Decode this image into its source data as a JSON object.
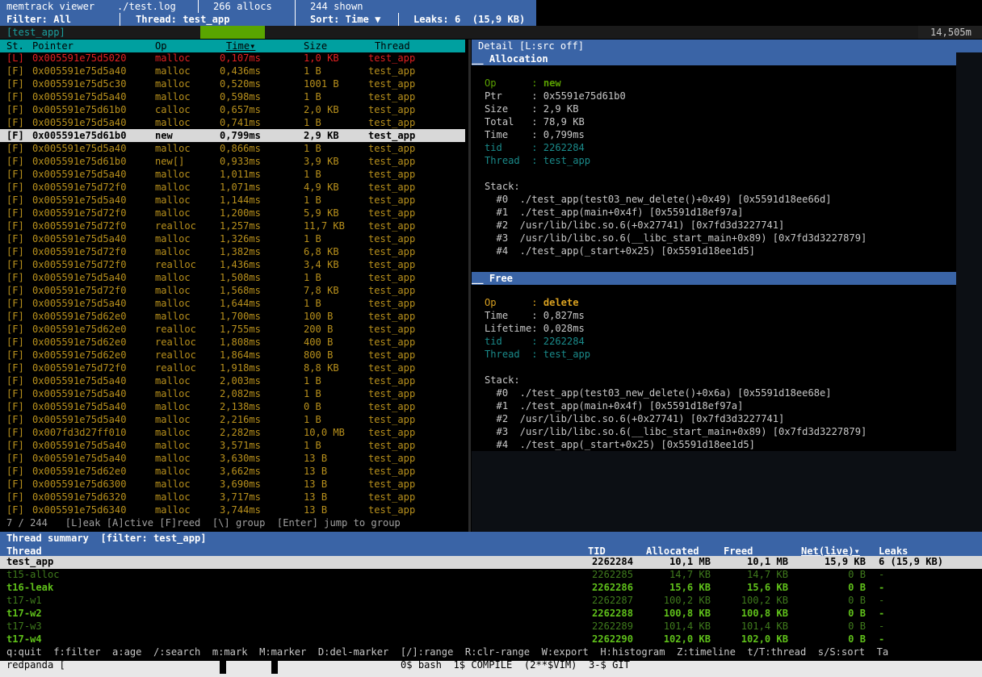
{
  "header": {
    "app_title": "memtrack viewer",
    "file": "./test.log",
    "allocs": "266 allocs",
    "shown": "244 shown",
    "filter": "Filter: All",
    "thread": "Thread: test_app",
    "sort": "Sort: Time ▼",
    "leaks": "Leaks: 6  (15,9 KB)"
  },
  "tabbar": {
    "group": "[test_app]",
    "right": "14,505m"
  },
  "list": {
    "columns": {
      "st": "St.",
      "pointer": "Pointer",
      "op": "Op",
      "time": "Time▾",
      "size": "Size",
      "thread": "Thread"
    },
    "rows": [
      {
        "st": "[L]",
        "ptr": "0x005591e75d5020",
        "op": "malloc",
        "time": "0,107ms",
        "size": "1,0 KB",
        "thread": "test_app",
        "kind": "leak"
      },
      {
        "st": "[F]",
        "ptr": "0x005591e75d5a40",
        "op": "malloc",
        "time": "0,436ms",
        "size": "1 B",
        "thread": "test_app",
        "kind": "freed"
      },
      {
        "st": "[F]",
        "ptr": "0x005591e75d5c30",
        "op": "malloc",
        "time": "0,520ms",
        "size": "1001 B",
        "thread": "test_app",
        "kind": "freed"
      },
      {
        "st": "[F]",
        "ptr": "0x005591e75d5a40",
        "op": "malloc",
        "time": "0,598ms",
        "size": "1 B",
        "thread": "test_app",
        "kind": "freed"
      },
      {
        "st": "[F]",
        "ptr": "0x005591e75d61b0",
        "op": "calloc",
        "time": "0,657ms",
        "size": "2,0 KB",
        "thread": "test_app",
        "kind": "freed"
      },
      {
        "st": "[F]",
        "ptr": "0x005591e75d5a40",
        "op": "malloc",
        "time": "0,741ms",
        "size": "1 B",
        "thread": "test_app",
        "kind": "freed"
      },
      {
        "st": "[F]",
        "ptr": "0x005591e75d61b0",
        "op": "new",
        "time": "0,799ms",
        "size": "2,9 KB",
        "thread": "test_app",
        "kind": "selected"
      },
      {
        "st": "[F]",
        "ptr": "0x005591e75d5a40",
        "op": "malloc",
        "time": "0,866ms",
        "size": "1 B",
        "thread": "test_app",
        "kind": "freed"
      },
      {
        "st": "[F]",
        "ptr": "0x005591e75d61b0",
        "op": "new[]",
        "time": "0,933ms",
        "size": "3,9 KB",
        "thread": "test_app",
        "kind": "freed"
      },
      {
        "st": "[F]",
        "ptr": "0x005591e75d5a40",
        "op": "malloc",
        "time": "1,011ms",
        "size": "1 B",
        "thread": "test_app",
        "kind": "freed"
      },
      {
        "st": "[F]",
        "ptr": "0x005591e75d72f0",
        "op": "malloc",
        "time": "1,071ms",
        "size": "4,9 KB",
        "thread": "test_app",
        "kind": "freed"
      },
      {
        "st": "[F]",
        "ptr": "0x005591e75d5a40",
        "op": "malloc",
        "time": "1,144ms",
        "size": "1 B",
        "thread": "test_app",
        "kind": "freed"
      },
      {
        "st": "[F]",
        "ptr": "0x005591e75d72f0",
        "op": "malloc",
        "time": "1,200ms",
        "size": "5,9 KB",
        "thread": "test_app",
        "kind": "freed"
      },
      {
        "st": "[F]",
        "ptr": "0x005591e75d72f0",
        "op": "realloc",
        "time": "1,257ms",
        "size": "11,7 KB",
        "thread": "test_app",
        "kind": "freed"
      },
      {
        "st": "[F]",
        "ptr": "0x005591e75d5a40",
        "op": "malloc",
        "time": "1,326ms",
        "size": "1 B",
        "thread": "test_app",
        "kind": "freed"
      },
      {
        "st": "[F]",
        "ptr": "0x005591e75d72f0",
        "op": "malloc",
        "time": "1,382ms",
        "size": "6,8 KB",
        "thread": "test_app",
        "kind": "freed"
      },
      {
        "st": "[F]",
        "ptr": "0x005591e75d72f0",
        "op": "realloc",
        "time": "1,436ms",
        "size": "3,4 KB",
        "thread": "test_app",
        "kind": "freed"
      },
      {
        "st": "[F]",
        "ptr": "0x005591e75d5a40",
        "op": "malloc",
        "time": "1,508ms",
        "size": "1 B",
        "thread": "test_app",
        "kind": "freed"
      },
      {
        "st": "[F]",
        "ptr": "0x005591e75d72f0",
        "op": "malloc",
        "time": "1,568ms",
        "size": "7,8 KB",
        "thread": "test_app",
        "kind": "freed"
      },
      {
        "st": "[F]",
        "ptr": "0x005591e75d5a40",
        "op": "malloc",
        "time": "1,644ms",
        "size": "1 B",
        "thread": "test_app",
        "kind": "freed"
      },
      {
        "st": "[F]",
        "ptr": "0x005591e75d62e0",
        "op": "malloc",
        "time": "1,700ms",
        "size": "100 B",
        "thread": "test_app",
        "kind": "freed"
      },
      {
        "st": "[F]",
        "ptr": "0x005591e75d62e0",
        "op": "realloc",
        "time": "1,755ms",
        "size": "200 B",
        "thread": "test_app",
        "kind": "freed"
      },
      {
        "st": "[F]",
        "ptr": "0x005591e75d62e0",
        "op": "realloc",
        "time": "1,808ms",
        "size": "400 B",
        "thread": "test_app",
        "kind": "freed"
      },
      {
        "st": "[F]",
        "ptr": "0x005591e75d62e0",
        "op": "realloc",
        "time": "1,864ms",
        "size": "800 B",
        "thread": "test_app",
        "kind": "freed"
      },
      {
        "st": "[F]",
        "ptr": "0x005591e75d72f0",
        "op": "realloc",
        "time": "1,918ms",
        "size": "8,8 KB",
        "thread": "test_app",
        "kind": "freed"
      },
      {
        "st": "[F]",
        "ptr": "0x005591e75d5a40",
        "op": "malloc",
        "time": "2,003ms",
        "size": "1 B",
        "thread": "test_app",
        "kind": "freed"
      },
      {
        "st": "[F]",
        "ptr": "0x005591e75d5a40",
        "op": "malloc",
        "time": "2,082ms",
        "size": "1 B",
        "thread": "test_app",
        "kind": "freed"
      },
      {
        "st": "[F]",
        "ptr": "0x005591e75d5a40",
        "op": "malloc",
        "time": "2,138ms",
        "size": "0 B",
        "thread": "test_app",
        "kind": "freed"
      },
      {
        "st": "[F]",
        "ptr": "0x005591e75d5a40",
        "op": "malloc",
        "time": "2,216ms",
        "size": "1 B",
        "thread": "test_app",
        "kind": "freed"
      },
      {
        "st": "[F]",
        "ptr": "0x007fd3d27ff010",
        "op": "malloc",
        "time": "2,282ms",
        "size": "10,0 MB",
        "thread": "test_app",
        "kind": "freed"
      },
      {
        "st": "[F]",
        "ptr": "0x005591e75d5a40",
        "op": "malloc",
        "time": "3,571ms",
        "size": "1 B",
        "thread": "test_app",
        "kind": "freed"
      },
      {
        "st": "[F]",
        "ptr": "0x005591e75d5a40",
        "op": "malloc",
        "time": "3,630ms",
        "size": "13 B",
        "thread": "test_app",
        "kind": "freed"
      },
      {
        "st": "[F]",
        "ptr": "0x005591e75d62e0",
        "op": "malloc",
        "time": "3,662ms",
        "size": "13 B",
        "thread": "test_app",
        "kind": "freed"
      },
      {
        "st": "[F]",
        "ptr": "0x005591e75d6300",
        "op": "malloc",
        "time": "3,690ms",
        "size": "13 B",
        "thread": "test_app",
        "kind": "freed"
      },
      {
        "st": "[F]",
        "ptr": "0x005591e75d6320",
        "op": "malloc",
        "time": "3,717ms",
        "size": "13 B",
        "thread": "test_app",
        "kind": "freed"
      },
      {
        "st": "[F]",
        "ptr": "0x005591e75d6340",
        "op": "malloc",
        "time": "3,744ms",
        "size": "13 B",
        "thread": "test_app",
        "kind": "freed"
      }
    ],
    "footer": "7 / 244   [L]eak [A]ctive [F]reed  [\\] group  [Enter] jump to group"
  },
  "detail": {
    "title": "Detail [L:src off]",
    "alloc_header": "__ Allocation",
    "alloc": {
      "op_key": "Op      :",
      "op_val": "new",
      "ptr": "Ptr     : 0x5591e75d61b0",
      "size": "Size    : 2,9 KB",
      "total": "Total   : 78,9 KB",
      "time": "Time    : 0,799ms",
      "tid": "tid     : 2262284",
      "thread": "Thread  : test_app",
      "stack_label": "Stack:",
      "stack": [
        "  #0  ./test_app(test03_new_delete()+0x49) [0x5591d18ee66d]",
        "  #1  ./test_app(main+0x4f) [0x5591d18ef97a]",
        "  #2  /usr/lib/libc.so.6(+0x27741) [0x7fd3d3227741]",
        "  #3  /usr/lib/libc.so.6(__libc_start_main+0x89) [0x7fd3d3227879]",
        "  #4  ./test_app(_start+0x25) [0x5591d18ee1d5]"
      ]
    },
    "free_header": "__ Free",
    "free": {
      "op_key": "Op      :",
      "op_val": "delete",
      "time": "Time    : 0,827ms",
      "lifetime": "Lifetime: 0,028ms",
      "tid": "tid     : 2262284",
      "thread": "Thread  : test_app",
      "stack_label": "Stack:",
      "stack": [
        "  #0  ./test_app(test03_new_delete()+0x6a) [0x5591d18ee68e]",
        "  #1  ./test_app(main+0x4f) [0x5591d18ef97a]",
        "  #2  /usr/lib/libc.so.6(+0x27741) [0x7fd3d3227741]",
        "  #3  /usr/lib/libc.so.6(__libc_start_main+0x89) [0x7fd3d3227879]",
        "  #4  ./test_app(_start+0x25) [0x5591d18ee1d5]"
      ]
    }
  },
  "threads": {
    "title": "Thread summary  [filter: test_app]",
    "columns": {
      "thread": "Thread",
      "tid": "TID",
      "allocated": "Allocated",
      "freed": "Freed",
      "net": "Net(live)▾",
      "leaks": "Leaks"
    },
    "rows": [
      {
        "thread": "test_app",
        "tid": "2262284",
        "allocated": "10,1 MB",
        "freed": "10,1 MB",
        "net": "15,9 KB",
        "leaks": "6 (15,9 KB)",
        "kind": "selected"
      },
      {
        "thread": "t15-alloc",
        "tid": "2262285",
        "allocated": "14,7 KB",
        "freed": "14,7 KB",
        "net": "0 B",
        "leaks": "-",
        "kind": "dim"
      },
      {
        "thread": "t16-leak",
        "tid": "2262286",
        "allocated": "15,6 KB",
        "freed": "15,6 KB",
        "net": "0 B",
        "leaks": "-",
        "kind": "bright"
      },
      {
        "thread": "t17-w1",
        "tid": "2262287",
        "allocated": "100,2 KB",
        "freed": "100,2 KB",
        "net": "0 B",
        "leaks": "-",
        "kind": "dim"
      },
      {
        "thread": "t17-w2",
        "tid": "2262288",
        "allocated": "100,8 KB",
        "freed": "100,8 KB",
        "net": "0 B",
        "leaks": "-",
        "kind": "bright"
      },
      {
        "thread": "t17-w3",
        "tid": "2262289",
        "allocated": "101,4 KB",
        "freed": "101,4 KB",
        "net": "0 B",
        "leaks": "-",
        "kind": "dim"
      },
      {
        "thread": "t17-w4",
        "tid": "2262290",
        "allocated": "102,0 KB",
        "freed": "102,0 KB",
        "net": "0 B",
        "leaks": "-",
        "kind": "bright"
      }
    ]
  },
  "keys": "q:quit  f:filter  a:age  /:search  m:mark  M:marker  D:del-marker  [/]:range  R:clr-range  W:export  H:histogram  Z:timeline  t/T:thread  s/S:sort  Ta",
  "status": {
    "session": "redpanda [",
    "windows": "0$ bash  1$ COMPILE  (2**$VIM)  3-$ GIT"
  },
  "colors": {
    "header_bg": "#3a64a6",
    "list_header_bg": "#00a0a0",
    "leak": "#e02020",
    "freed": "#b8901c",
    "green": "#5aa000",
    "cyan": "#1a8a8a",
    "selection": "#d8d8d8"
  }
}
